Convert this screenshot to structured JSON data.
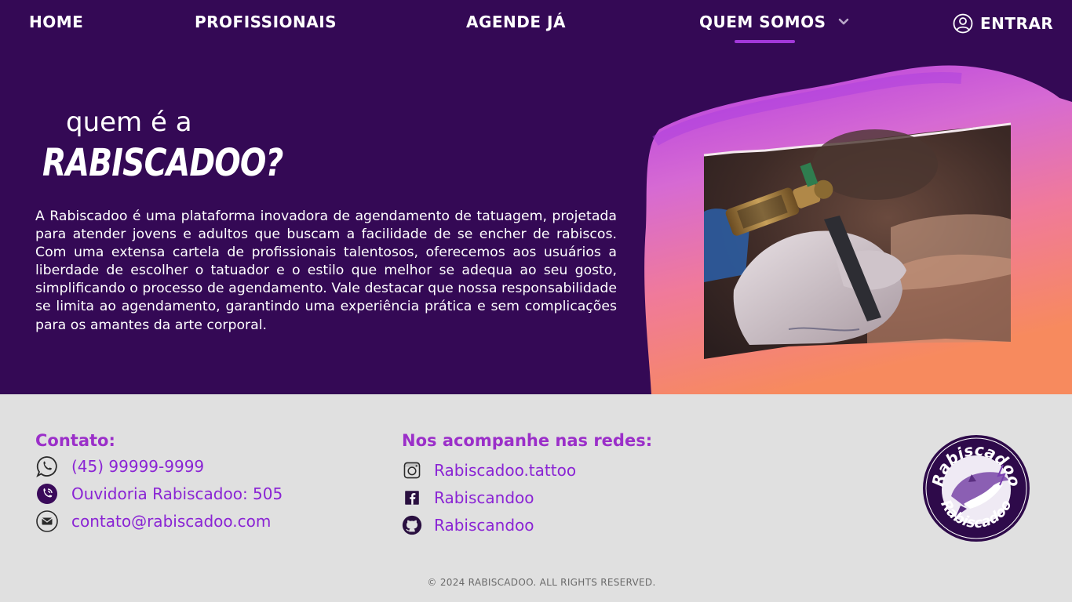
{
  "nav": {
    "home": "HOME",
    "profissionais": "PROFISSIONAIS",
    "agende": "AGENDE JÁ",
    "quem_somos": "QUEM SOMOS",
    "login": "ENTRAR"
  },
  "hero": {
    "heading_small": "quem é a",
    "heading_brand": "RABISCADOO?",
    "description": "A Rabiscadoo é uma plataforma inovadora de agendamento de tatuagem, projetada para atender jovens e adultos que buscam a facilidade de se encher de rabiscos. Com uma extensa cartela de profissionais talentosos, oferecemos aos usuários a liberdade de escolher o tatuador e o estilo que melhor se adequa ao seu gosto, simplificando o processo de agendamento. Vale destacar que nossa responsabilidade se limita ao agendamento, garantindo uma experiência prática e sem complicações para os amantes da arte corporal."
  },
  "footer": {
    "contato_title": "Contato:",
    "phone": "(45) 99999-9999",
    "ouvidoria": "Ouvidoria Rabiscadoo: 505",
    "email": "contato@rabiscadoo.com",
    "redes_title": "Nos acompanhe nas redes:",
    "instagram": "Rabiscadoo.tattoo",
    "facebook": "Rabiscandoo",
    "github": "Rabiscandoo",
    "copyright": "© 2024 RABISCADOO. ALL RIGHTS RESERVED.",
    "logo_text": "Rabiscadoo"
  },
  "colors": {
    "header_bg": "#340955",
    "accent": "#a238d9",
    "link": "#8a24d4",
    "footer_bg": "#e0e0e0"
  },
  "icons": {
    "chevron": "chevron-down-icon",
    "user": "user-icon",
    "whatsapp": "whatsapp-icon",
    "phone": "phone-icon",
    "mail": "mail-icon",
    "instagram": "instagram-icon",
    "facebook": "facebook-icon",
    "github": "github-icon"
  }
}
